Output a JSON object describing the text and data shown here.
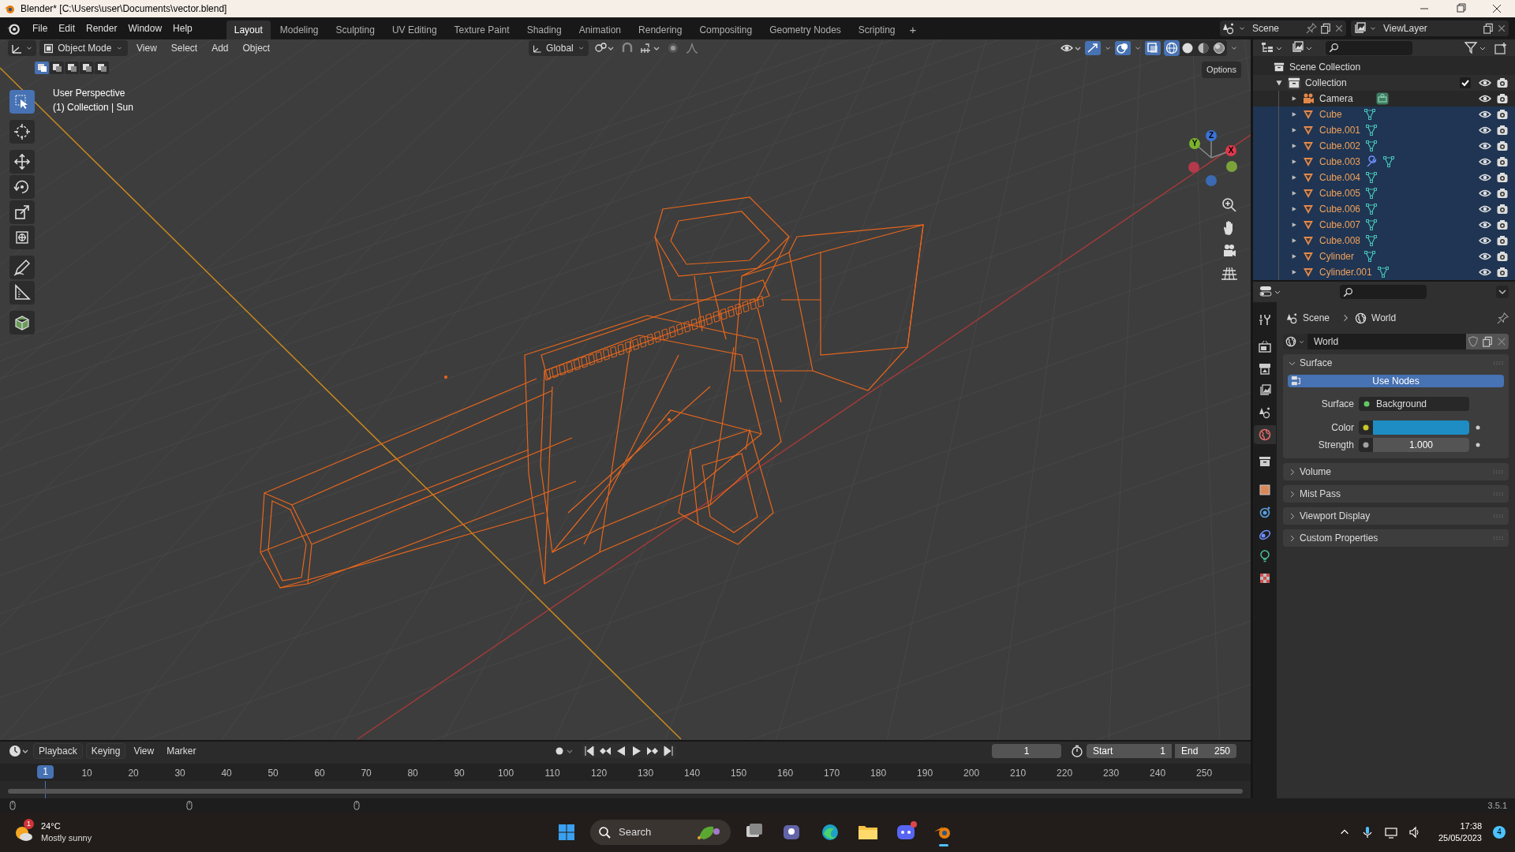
{
  "window": {
    "title": "Blender* [C:\\Users\\user\\Documents\\vector.blend]"
  },
  "menus": [
    "File",
    "Edit",
    "Render",
    "Window",
    "Help"
  ],
  "workspaces": [
    {
      "label": "Layout",
      "selected": true
    },
    {
      "label": "Modeling",
      "selected": false
    },
    {
      "label": "Sculpting",
      "selected": false
    },
    {
      "label": "UV Editing",
      "selected": false
    },
    {
      "label": "Texture Paint",
      "selected": false
    },
    {
      "label": "Shading",
      "selected": false
    },
    {
      "label": "Animation",
      "selected": false
    },
    {
      "label": "Rendering",
      "selected": false
    },
    {
      "label": "Compositing",
      "selected": false
    },
    {
      "label": "Geometry Nodes",
      "selected": false
    },
    {
      "label": "Scripting",
      "selected": false
    }
  ],
  "add_workspace": "+",
  "scene": "Scene",
  "view_layer": "ViewLayer",
  "viewport": {
    "mode": "Object Mode",
    "menus": [
      "View",
      "Select",
      "Add",
      "Object"
    ],
    "select_modes": [
      {
        "selected": true
      },
      {
        "selected": false
      },
      {
        "selected": false
      },
      {
        "selected": false
      },
      {
        "selected": false
      }
    ],
    "orientation": "Global",
    "options": "Options",
    "view_name": "User Perspective",
    "context": "(1) Collection | Sun",
    "tools": [
      {
        "kind": "select",
        "selected": true
      },
      {
        "kind": "cursor",
        "selected": false
      },
      {
        "kind": "move",
        "selected": false
      },
      {
        "kind": "rotate",
        "selected": false
      },
      {
        "kind": "scale",
        "selected": false
      },
      {
        "kind": "transform",
        "selected": false
      },
      {
        "kind": "annotate",
        "selected": false
      },
      {
        "kind": "measure",
        "selected": false
      },
      {
        "kind": "add_cube",
        "selected": false
      }
    ],
    "gizmo": {
      "x": "X",
      "y": "Y",
      "z": "Z"
    },
    "shading": [
      {
        "kind": "wireframe",
        "selected": true
      },
      {
        "kind": "solid",
        "selected": false
      },
      {
        "kind": "material",
        "selected": false
      },
      {
        "kind": "rendered",
        "selected": false
      }
    ]
  },
  "outliner": {
    "root": "Scene Collection",
    "collection": {
      "label": "Collection",
      "checked": true,
      "expanded": true,
      "children": [
        {
          "label": "Camera",
          "kind": "camera",
          "selected": false,
          "modifier": false
        },
        {
          "label": "Cube",
          "kind": "mesh",
          "selected": true,
          "modifier": false
        },
        {
          "label": "Cube.001",
          "kind": "mesh",
          "selected": true,
          "modifier": false
        },
        {
          "label": "Cube.002",
          "kind": "mesh",
          "selected": true,
          "modifier": false
        },
        {
          "label": "Cube.003",
          "kind": "mesh",
          "selected": true,
          "modifier": true
        },
        {
          "label": "Cube.004",
          "kind": "mesh",
          "selected": true,
          "modifier": false
        },
        {
          "label": "Cube.005",
          "kind": "mesh",
          "selected": true,
          "modifier": false
        },
        {
          "label": "Cube.006",
          "kind": "mesh",
          "selected": true,
          "modifier": false
        },
        {
          "label": "Cube.007",
          "kind": "mesh",
          "selected": true,
          "modifier": false
        },
        {
          "label": "Cube.008",
          "kind": "mesh",
          "selected": true,
          "modifier": false
        },
        {
          "label": "Cylinder",
          "kind": "mesh",
          "selected": true,
          "modifier": false
        },
        {
          "label": "Cylinder.001",
          "kind": "mesh",
          "selected": true,
          "modifier": false
        }
      ]
    }
  },
  "properties": {
    "tabs": [
      {
        "kind": "tool",
        "selected": false
      },
      {
        "kind": "render",
        "selected": false
      },
      {
        "kind": "output",
        "selected": false
      },
      {
        "kind": "view_layer",
        "selected": false
      },
      {
        "kind": "scene",
        "selected": false
      },
      {
        "kind": "world",
        "selected": true
      },
      {
        "kind": "collection",
        "selected": false
      },
      {
        "kind": "object",
        "selected": false
      },
      {
        "kind": "physics",
        "selected": false
      },
      {
        "kind": "constraints",
        "selected": false
      },
      {
        "kind": "data",
        "selected": false
      },
      {
        "kind": "texture",
        "selected": false
      }
    ],
    "breadcrumb": [
      "Scene",
      "World"
    ],
    "world": "World",
    "panels": [
      {
        "title": "Surface",
        "expanded": true,
        "button": "Use Nodes",
        "fields": [
          {
            "label": "Surface",
            "kind": "shader",
            "value": "Background"
          },
          {
            "label": "Color",
            "kind": "color",
            "color": "#1d8dc4"
          },
          {
            "label": "Strength",
            "kind": "number",
            "value": "1.000"
          }
        ]
      },
      {
        "title": "Volume",
        "expanded": false
      },
      {
        "title": "Mist Pass",
        "expanded": false
      },
      {
        "title": "Viewport Display",
        "expanded": false
      },
      {
        "title": "Custom Properties",
        "expanded": false
      }
    ]
  },
  "timeline": {
    "menus": [
      "Playback",
      "Keying",
      "View",
      "Marker"
    ],
    "current_frame": "1",
    "start_label": "Start",
    "start": "1",
    "end_label": "End",
    "end": "250",
    "ruler_current": "1",
    "ruler": [
      "10",
      "20",
      "30",
      "40",
      "50",
      "60",
      "70",
      "80",
      "90",
      "100",
      "110",
      "120",
      "130",
      "140",
      "150",
      "160",
      "170",
      "180",
      "190",
      "200",
      "210",
      "220",
      "230",
      "240",
      "250"
    ]
  },
  "status": {
    "version": "3.5.1"
  },
  "taskbar": {
    "weather_badge": "1",
    "temperature": "24°C",
    "weather": "Mostly sunny",
    "search": "Search",
    "time": "17:38",
    "date": "25/05/2023",
    "notifications": "4"
  }
}
